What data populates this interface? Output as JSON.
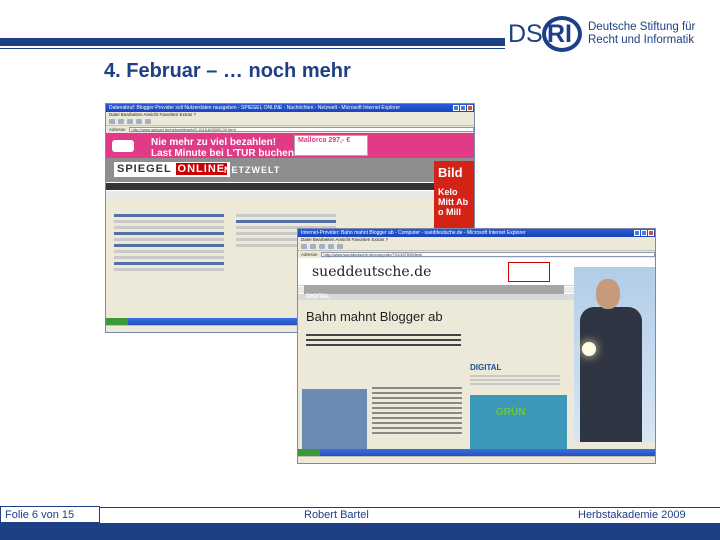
{
  "logo": {
    "ds": "DS",
    "ri": "RI",
    "line1": "Deutsche Stiftung für",
    "line2": "Recht und Informatik"
  },
  "slide": {
    "title": "4. Februar – … noch mehr"
  },
  "spiegel_window": {
    "title": "Datenabruf: Blogger-Provider soll Nutzerdaten rausgeben - SPIEGEL ONLINE - Nachrichten - Netzwelt - Microsoft Internet Explorer",
    "menu": "Datei  Bearbeiten  Ansicht  Favoriten  Extras  ?",
    "address_label": "Adresse",
    "url": "http://www.spiegel.de/netzwelt/web/0,1518,605000,00.html",
    "ad_line1": "Nie mehr zu viel bezahlen!",
    "ad_line2": "Last Minute bei L'TUR buchen!",
    "ad_offer": "Mallorca 297,- €",
    "logo_a": "SPIEGEL",
    "logo_b": "ONLINE",
    "section": "NETZWELT",
    "bild_logo": "Bild",
    "bild_text": "Kelo Mitt Ab o Mill"
  },
  "sueddeutsche_window": {
    "title": "Internet-Provider: Bahn mahnt Blogger ab - Computer - sueddeutsche.de - Microsoft Internet Explorer",
    "menu": "Datei  Bearbeiten  Ansicht  Favoriten  Extras  ?",
    "address_label": "Adresse",
    "url": "http://www.sueddeutsche.de/computer/741/457695/text/",
    "logo": "sueddeutsche.de",
    "section": "DIGITAL",
    "headline": "Bahn mahnt Blogger ab",
    "side_title": "DIGITAL",
    "green_ad": "GRÜN"
  },
  "footer": {
    "slide_no": "Folie 6 von 15",
    "author": "Robert Bartel",
    "event": "Herbstakademie 2009"
  }
}
